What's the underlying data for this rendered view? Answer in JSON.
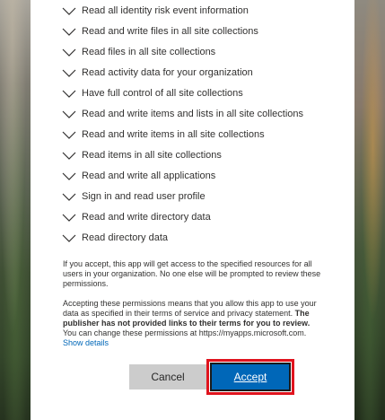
{
  "permissions": [
    "Read all identity risk event information",
    "Read and write files in all site collections",
    "Read files in all site collections",
    "Read activity data for your organization",
    "Have full control of all site collections",
    "Read and write items and lists in all site collections",
    "Read and write items in all site collections",
    "Read items in all site collections",
    "Read and write all applications",
    "Sign in and read user profile",
    "Read and write directory data",
    "Read directory data"
  ],
  "consent": {
    "accept_notice": "If you accept, this app will get access to the specified resources for all users in your organization. No one else will be prompted to review these permissions.",
    "terms_part1": "Accepting these permissions means that you allow this app to use your data as specified in their terms of service and privacy statement. ",
    "terms_bold": "The publisher has not provided links to their terms for you to review.",
    "terms_part2": " You can change these permissions at https://myapps.microsoft.com. ",
    "show_details_link": "Show details"
  },
  "buttons": {
    "cancel_label": "Cancel",
    "accept_label": "Accept"
  },
  "colors": {
    "accent": "#0067b8",
    "highlight": "#e0141e"
  }
}
